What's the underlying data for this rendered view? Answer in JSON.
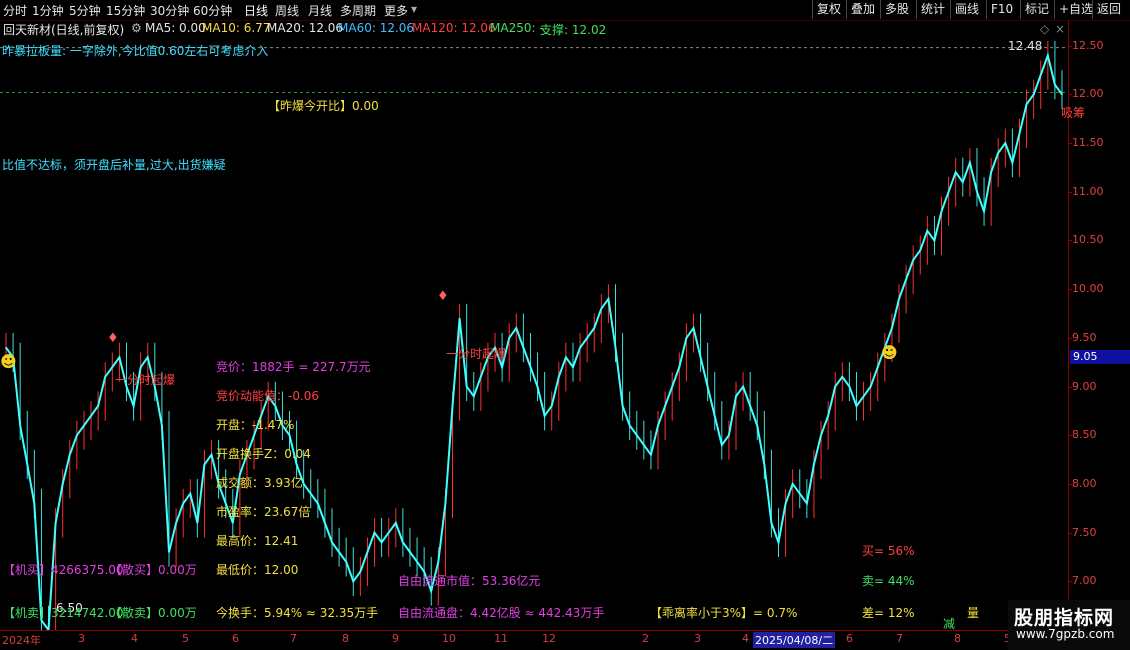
{
  "toolbar": {
    "tabs": [
      "分时",
      "1分钟",
      "5分钟",
      "15分钟",
      "30分钟",
      "60分钟",
      "日线",
      "周线",
      "月线",
      "多周期",
      "更多"
    ],
    "active_tab": "日线",
    "right_buttons": [
      "复权",
      "叠加",
      "多股",
      "统计",
      "画线",
      "F10",
      "标记",
      "+自选",
      "返回"
    ]
  },
  "info": {
    "stock": "回天新材(日线,前复权)",
    "ma5": "MA5: 0.00",
    "ma10": "MA10: 6.77",
    "ma20": "MA20: 12.06",
    "ma60": "MA60: 12.06",
    "ma120": "MA120: 12.06",
    "ma250": "MA250: -",
    "support": "支撑: 12.02"
  },
  "colors": {
    "candle_up": "#ff3030",
    "candle_down": "#40e0e0",
    "ma_line": "#40ffff",
    "grid_dash": "#3a8a3a",
    "axis": "#8b0000"
  },
  "annotations": {
    "top_note": "昨暴拉板量: 一字除外,今比值0.60左右可考虑介入",
    "open_ratio": "【昨爆今开比】0.00",
    "warning": "比值不达标，须开盘后补量,过大,出货嫌疑",
    "burst1": "一分时起爆",
    "burst2": "一分时起爆",
    "high_label": "12.48",
    "low_label": "6.50",
    "signal_right": "吸筹"
  },
  "stats": {
    "bid": "竞价：1882手 = 227.7万元",
    "bid_power": "竞价动能值：-0.06",
    "open_pct": "开盘：-1.47%",
    "open_turnover": "开盘换手Z：0.04",
    "amount": "成交额：3.93亿",
    "pe": "市盈率：23.67倍",
    "high": "最高价：12.41",
    "low": "最低价：12.00",
    "turnover": "今换手：5.94% ≈ 32.35万手",
    "float_mv": "自由流通市值：53.36亿元",
    "float_shares": "自由流通盘：4.42亿股 ≈ 442.43万手",
    "deviation": "【乖离率小于3%】= 0.7%",
    "buy_pct": "买= 56%",
    "sell_pct": "卖= 44%",
    "diff_pct": "差= 12%",
    "jimai": "【机买】4266375.00",
    "jimai_amt": "【散买】0.00万",
    "jimai_sell": "【机卖】3214742.00",
    "jimai_sell_amt": "【散卖】0.00万",
    "jian": "减",
    "liang": "量"
  },
  "price_axis": [
    "12.50",
    "12.00",
    "11.50",
    "11.00",
    "10.50",
    "10.00",
    "9.50",
    "9.00",
    "8.50",
    "8.00",
    "7.50",
    "7.00"
  ],
  "current_price": "9.05",
  "dates": {
    "year": "2024年",
    "months": [
      "3",
      "4",
      "5",
      "6",
      "7",
      "8",
      "9",
      "10",
      "11",
      "12",
      "2",
      "3",
      "4",
      "6",
      "7",
      "8"
    ],
    "highlight": "2025/04/08/二",
    "tail": "5"
  },
  "watermark": {
    "name": "股朋指标网",
    "url": "www.7gpzb.com"
  },
  "chart_data": {
    "type": "line",
    "title": "",
    "ylim": [
      6.5,
      12.6
    ],
    "series": [
      {
        "values": [
          9.4,
          9.3,
          8.6,
          8.2,
          7.8,
          6.6,
          6.5,
          7.6,
          8.0,
          8.3,
          8.5,
          8.6,
          8.7,
          8.8,
          9.1,
          9.2,
          9.3,
          9.0,
          8.8,
          9.2,
          9.3,
          9.0,
          8.6,
          7.3,
          7.6,
          7.8,
          7.9,
          7.6,
          8.2,
          8.3,
          8.0,
          7.8,
          7.6,
          8.1,
          8.3,
          8.5,
          8.7,
          8.9,
          8.8,
          8.6,
          8.5,
          8.2,
          8.0,
          7.9,
          7.8,
          7.6,
          7.4,
          7.3,
          7.2,
          7.0,
          7.1,
          7.3,
          7.5,
          7.4,
          7.5,
          7.6,
          7.4,
          7.3,
          7.2,
          7.1,
          6.9,
          7.2,
          7.8,
          8.8,
          9.7,
          9.0,
          8.9,
          9.1,
          9.3,
          9.4,
          9.2,
          9.5,
          9.6,
          9.4,
          9.2,
          9.0,
          8.7,
          8.8,
          9.1,
          9.3,
          9.2,
          9.4,
          9.5,
          9.6,
          9.8,
          9.9,
          9.4,
          8.8,
          8.6,
          8.5,
          8.4,
          8.3,
          8.6,
          8.8,
          9.0,
          9.2,
          9.5,
          9.6,
          9.3,
          9.0,
          8.7,
          8.4,
          8.5,
          8.9,
          9.0,
          8.8,
          8.6,
          8.2,
          7.6,
          7.4,
          7.8,
          8.0,
          7.9,
          7.8,
          8.2,
          8.5,
          8.7,
          9.0,
          9.1,
          9.0,
          8.8,
          8.9,
          9.0,
          9.2,
          9.4,
          9.6,
          9.9,
          10.1,
          10.3,
          10.4,
          10.6,
          10.5,
          10.8,
          11.0,
          11.2,
          11.1,
          11.3,
          11.0,
          10.8,
          11.2,
          11.4,
          11.5,
          11.3,
          11.6,
          11.9,
          12.0,
          12.2,
          12.4,
          12.1,
          12.0
        ]
      }
    ]
  }
}
